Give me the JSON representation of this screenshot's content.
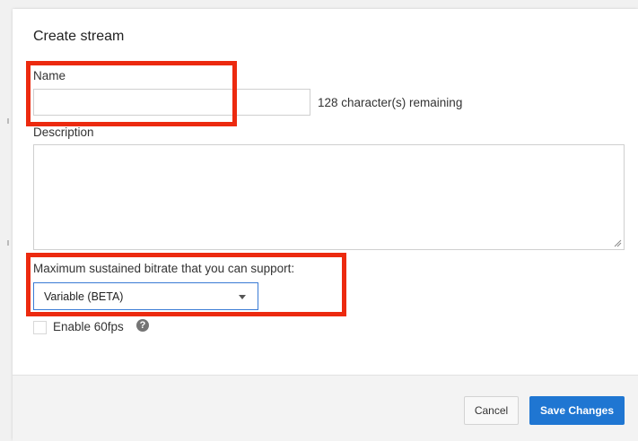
{
  "dialog": {
    "title": "Create stream",
    "name_label": "Name",
    "name_value": "",
    "name_remaining": "128 character(s) remaining",
    "description_label": "Description",
    "description_value": "",
    "bitrate_label": "Maximum sustained bitrate that you can support:",
    "bitrate_selected": "Variable (BETA)",
    "fps_label": "Enable 60fps",
    "fps_checked": false,
    "help_icon": "?"
  },
  "footer": {
    "cancel_label": "Cancel",
    "save_label": "Save Changes"
  },
  "colors": {
    "highlight": "#ec2a0f",
    "primary_button": "#1f76d2",
    "select_border": "#3a7bd5"
  },
  "icons": [
    "chevron-down-icon",
    "help-icon",
    "resize-grip-icon"
  ]
}
